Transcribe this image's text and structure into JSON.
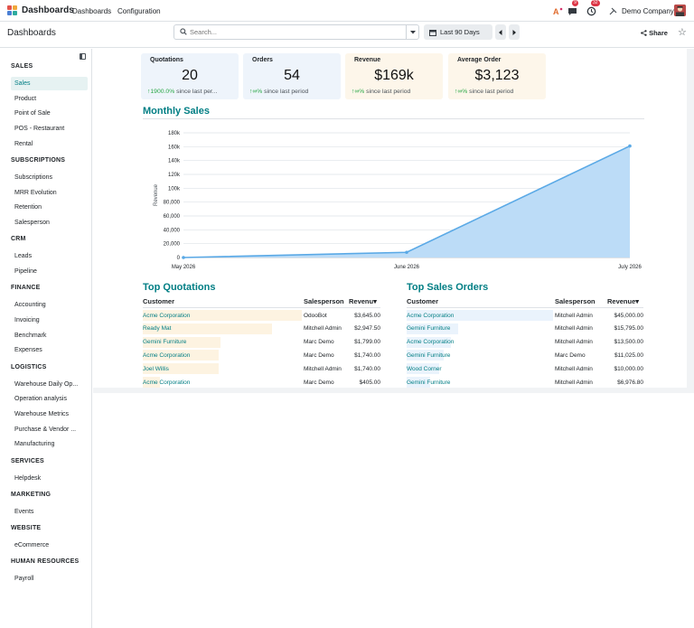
{
  "navbar": {
    "brand": "Dashboards",
    "menus": [
      "Dashboards",
      "Configuration"
    ],
    "chat_badge": "9",
    "activity_badge": "32",
    "company": "Demo Company"
  },
  "control_panel": {
    "title": "Dashboards",
    "search_placeholder": "Search...",
    "date_range": "Last 90 Days",
    "share_label": "Share"
  },
  "sidebar": {
    "sections": [
      {
        "title": "SALES",
        "items": [
          "Sales",
          "Product",
          "Point of Sale",
          "POS - Restaurant",
          "Rental"
        ]
      },
      {
        "title": "SUBSCRIPTIONS",
        "items": [
          "Subscriptions",
          "MRR Evolution",
          "Retention",
          "Salesperson"
        ]
      },
      {
        "title": "CRM",
        "items": [
          "Leads",
          "Pipeline"
        ]
      },
      {
        "title": "FINANCE",
        "items": [
          "Accounting",
          "Invoicing",
          "Benchmark",
          "Expenses"
        ]
      },
      {
        "title": "LOGISTICS",
        "items": [
          "Warehouse Daily Op...",
          "Operation analysis",
          "Warehouse Metrics",
          "Purchase & Vendor ...",
          "Manufacturing"
        ]
      },
      {
        "title": "SERVICES",
        "items": [
          "Helpdesk"
        ]
      },
      {
        "title": "MARKETING",
        "items": [
          "Events"
        ]
      },
      {
        "title": "WEBSITE",
        "items": [
          "eCommerce"
        ]
      },
      {
        "title": "HUMAN RESOURCES",
        "items": [
          "Payroll"
        ]
      }
    ],
    "active_item": "Sales"
  },
  "kpis": [
    {
      "label": "Quotations",
      "value": "20",
      "trend_value": "1900.0%",
      "trend_text": " since last per...",
      "bg": "#eef4fb"
    },
    {
      "label": "Orders",
      "value": "54",
      "trend_value": "∞%",
      "trend_text": " since last period",
      "bg": "#eef4fb"
    },
    {
      "label": "Revenue",
      "value": "$169k",
      "trend_value": "∞%",
      "trend_text": " since last period",
      "bg": "#fdf6ea"
    },
    {
      "label": "Average Order",
      "value": "$3,123",
      "trend_value": "∞%",
      "trend_text": " since last period",
      "bg": "#fdf6ea"
    }
  ],
  "monthly_sales": {
    "title": "Monthly Sales"
  },
  "chart_data": {
    "type": "area",
    "x": [
      "May 2026",
      "June 2026",
      "July 2026"
    ],
    "series": [
      {
        "values": [
          0,
          7500,
          161000
        ]
      }
    ],
    "ylabel": "Revenue",
    "yticks": [
      "0",
      "20,000",
      "40,000",
      "60,000",
      "80,000",
      "100k",
      "120k",
      "140k",
      "160k",
      "180k"
    ],
    "ylim": [
      0,
      180000
    ],
    "grid": true,
    "color": "#5aa9e6"
  },
  "top_quotations": {
    "title": "Top Quotations",
    "columns": [
      "Customer",
      "Salesperson",
      "Revenu▾"
    ],
    "rows": [
      {
        "customer": "Acme Corporation",
        "salesperson": "OdooBot",
        "revenue": "$3,645.00",
        "share": 1.0
      },
      {
        "customer": "Ready Mat",
        "salesperson": "Mitchell Admin",
        "revenue": "$2,947.50",
        "share": 0.81
      },
      {
        "customer": "Gemini Furniture",
        "salesperson": "Marc Demo",
        "revenue": "$1,799.00",
        "share": 0.49
      },
      {
        "customer": "Acme Corporation",
        "salesperson": "Marc Demo",
        "revenue": "$1,740.00",
        "share": 0.48
      },
      {
        "customer": "Joel Willis",
        "salesperson": "Mitchell Admin",
        "revenue": "$1,740.00",
        "share": 0.48
      },
      {
        "customer": "Acme Corporation",
        "salesperson": "Marc Demo",
        "revenue": "$405.00",
        "share": 0.11
      }
    ]
  },
  "top_sales_orders": {
    "title": "Top Sales Orders",
    "columns": [
      "Customer",
      "Salesperson",
      "Revenue▾"
    ],
    "rows": [
      {
        "customer": "Acme Corporation",
        "salesperson": "Mitchell Admin",
        "revenue": "$45,000.00",
        "share": 1.0
      },
      {
        "customer": "Gemini Furniture",
        "salesperson": "Mitchell Admin",
        "revenue": "$15,795.00",
        "share": 0.35
      },
      {
        "customer": "Acme Corporation",
        "salesperson": "Mitchell Admin",
        "revenue": "$13,500.00",
        "share": 0.3
      },
      {
        "customer": "Gemini Furniture",
        "salesperson": "Marc Demo",
        "revenue": "$11,025.00",
        "share": 0.25
      },
      {
        "customer": "Wood Corner",
        "salesperson": "Mitchell Admin",
        "revenue": "$10,000.00",
        "share": 0.22
      },
      {
        "customer": "Gemini Furniture",
        "salesperson": "Mitchell Admin",
        "revenue": "$6,976.80",
        "share": 0.16
      }
    ]
  }
}
